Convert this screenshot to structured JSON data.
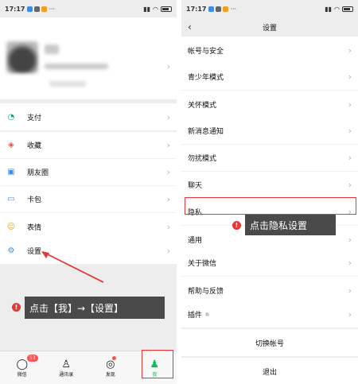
{
  "status_bar": {
    "time": "17:17"
  },
  "left": {
    "profile": {
      "name": "",
      "wechat_id": ""
    },
    "menu_group_1": [
      {
        "label": "支付",
        "icon": "payment-icon"
      }
    ],
    "menu_group_2": [
      {
        "label": "收藏",
        "icon": "favorites-icon"
      },
      {
        "label": "朋友圈",
        "icon": "moments-icon"
      },
      {
        "label": "卡包",
        "icon": "cards-icon"
      },
      {
        "label": "表情",
        "icon": "stickers-icon"
      }
    ],
    "menu_group_3": [
      {
        "label": "设置",
        "icon": "settings-icon"
      }
    ],
    "callout": "点击【我】→【设置】",
    "tabs": [
      {
        "label": "微信",
        "badge": "53"
      },
      {
        "label": "通讯录"
      },
      {
        "label": "发现"
      },
      {
        "label": "我"
      }
    ],
    "colors": {
      "accent": "#07c160",
      "highlight": "#e53935"
    }
  },
  "right": {
    "title": "设置",
    "group_1": [
      "帐号与安全"
    ],
    "group_2": [
      "青少年模式",
      "关怀模式"
    ],
    "group_3": [
      "新消息通知",
      "勿扰模式",
      "聊天",
      "隐私",
      "通用"
    ],
    "group_4": [
      "关于微信",
      "帮助与反馈"
    ],
    "group_5": [
      "插件"
    ],
    "switch_account": "切换帐号",
    "logout": "退出",
    "callout": "点击隐私设置"
  }
}
